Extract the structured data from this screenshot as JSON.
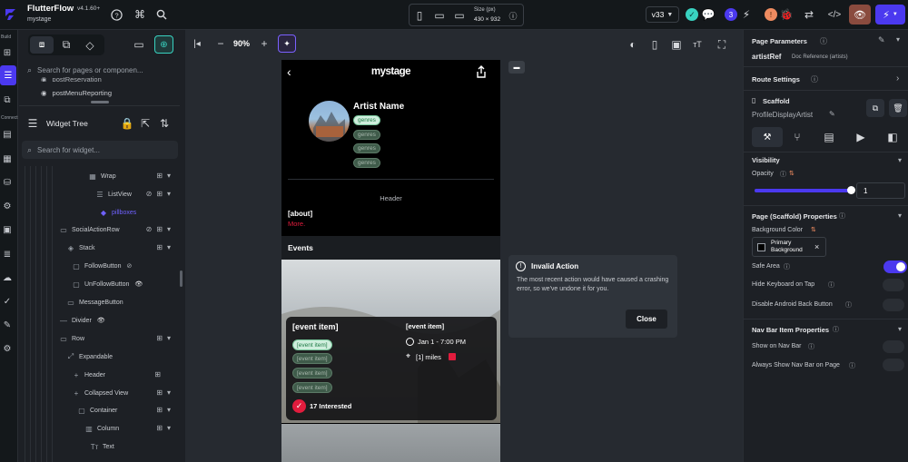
{
  "app": {
    "name": "FlutterFlow",
    "version": "v4.1.60+",
    "project": "mystage"
  },
  "topbar": {
    "size_label": "Size (px)",
    "size_value": "430 × 932",
    "version_tag": "v33",
    "badge_count": "3"
  },
  "rail": {
    "build_label": "Build",
    "connect_label": "Connect"
  },
  "pages_panel": {
    "search_placeholder": "Search for pages or componen...",
    "items": [
      "postReservation",
      "postMenuReporting"
    ]
  },
  "widget_tree": {
    "title": "Widget Tree",
    "search_placeholder": "Search for widget...",
    "rows": [
      {
        "label": "Wrap",
        "icon": "▦"
      },
      {
        "label": "ListView",
        "icon": "☰"
      },
      {
        "label": "pillboxes",
        "icon": "◆"
      },
      {
        "label": "SocialActionRow",
        "icon": "▭"
      },
      {
        "label": "Stack",
        "icon": "◈"
      },
      {
        "label": "FollowButton",
        "icon": "▢"
      },
      {
        "label": "UnFollowButton",
        "icon": "▢"
      },
      {
        "label": "MessageButton",
        "icon": "▭"
      },
      {
        "label": "Divider",
        "icon": "—"
      },
      {
        "label": "Row",
        "icon": "▭"
      },
      {
        "label": "Expandable",
        "icon": "⤢"
      },
      {
        "label": "Header",
        "icon": "+"
      },
      {
        "label": "Collapsed View",
        "icon": "+"
      },
      {
        "label": "Container",
        "icon": "▢"
      },
      {
        "label": "Column",
        "icon": "▥"
      },
      {
        "label": "Text",
        "icon": "Tт"
      }
    ]
  },
  "canvas": {
    "zoom": "90%"
  },
  "phone": {
    "brand": "mystage",
    "artist_name": "Artist Name",
    "genres": [
      "genres",
      "genres",
      "genres",
      "genres"
    ],
    "header_text": "Header",
    "about_text": "[about]",
    "more_text": "More.",
    "events_title": "Events",
    "event_card": {
      "title": "[event item]",
      "tags": [
        "[event item]",
        "[event item]",
        "[event item]",
        "[event item]"
      ],
      "interested": "17 Interested",
      "right_title": "[event item]",
      "date": "Jan 1 - 7:00 PM",
      "distance": "[1] miles"
    }
  },
  "invalid_action": {
    "title": "Invalid Action",
    "message": "The most recent action would have caused a crashing error, so we've undone it for you.",
    "close_label": "Close"
  },
  "right_panel": {
    "page_parameters": "Page Parameters",
    "param_name": "artistRef",
    "param_type": "Doc Reference (artists)",
    "route_settings": "Route Settings",
    "scaffold": "Scaffold",
    "scaffold_name": "ProfileDisplayArtist",
    "visibility": "Visibility",
    "opacity_label": "Opacity",
    "opacity_value": "1",
    "opacity_level": 1,
    "page_props": "Page (Scaffold) Properties",
    "bg_color_label": "Background Color",
    "bg_color_value": "Primary Background",
    "safe_area": "Safe Area",
    "hide_keyboard": "Hide Keyboard on Tap",
    "disable_back": "Disable Android Back Button",
    "nav_bar_props": "Nav Bar Item Properties",
    "show_nav": "Show on Nav Bar",
    "always_show_nav": "Always Show Nav Bar on Page"
  },
  "colors": {
    "accent": "#4b39ef",
    "success": "#39d2c0",
    "danger": "#e21c3d",
    "orange": "#ee8b60"
  }
}
